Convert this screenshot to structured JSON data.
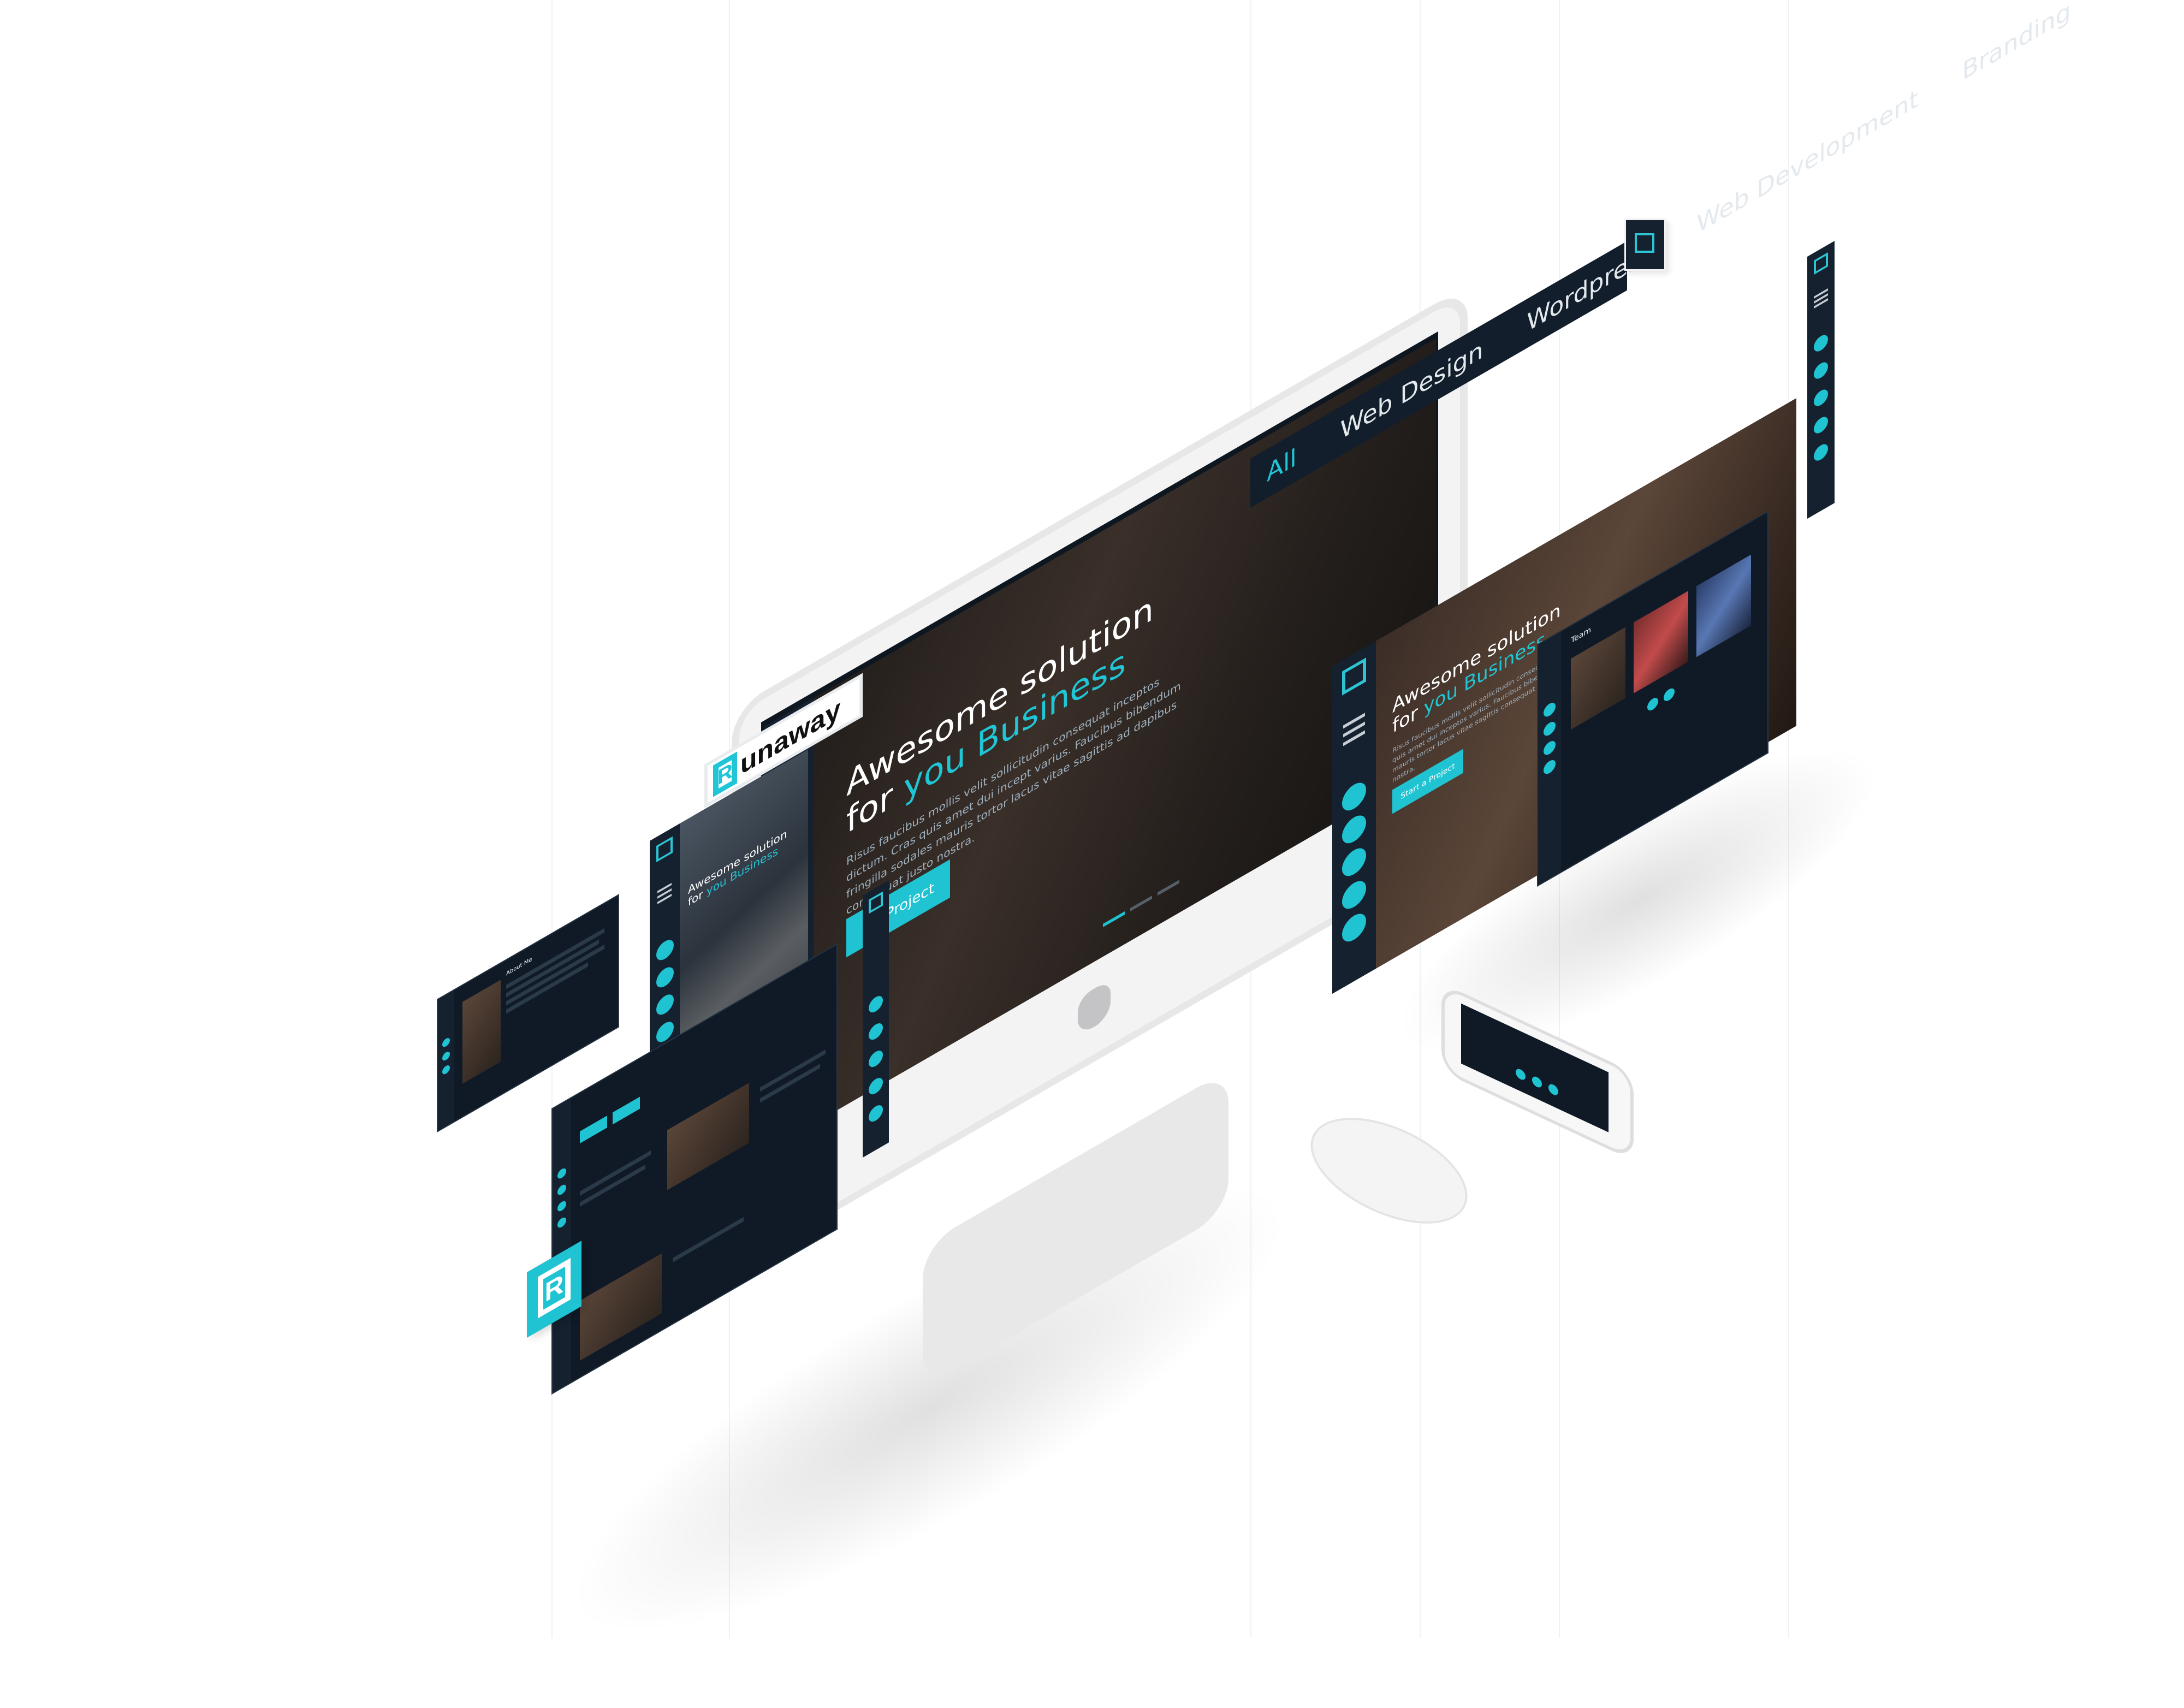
{
  "hero": {
    "title_line1": "Awesome solution",
    "title_for": "for",
    "title_accent": "you Business",
    "body": "Risus faucibus mollis velit sollicitudin consequat inceptos dictum. Cras quis amet dui incept varius. Faucibus bibendum fringilla sodales mauris tortor lacus vitae sagittis ad dapibus consequat justo nostra.",
    "cta_label": "Start a Project",
    "cta_partial": "t a Project"
  },
  "right_hero": {
    "title_line1": "Awesome solution",
    "title_for": "for",
    "title_accent": "you Business",
    "body": "Risus faucibus mollis velit sollicitudin consequat inceptos dictum. Cras quis amet dui inceptos varius. Faucibus bibendum fringilla sodales mauris tortor lacus vitae sagittis consequat dapibus consequat justo nostra.",
    "cta_label": "Start a Project"
  },
  "small_hero": {
    "title_line1": "Awesome solution",
    "title_for": "for",
    "title_accent": "you Business"
  },
  "filter_nav": {
    "items": [
      "All",
      "Web Design",
      "Wordpress",
      "Web Development",
      "Branding"
    ]
  },
  "brand": {
    "mark": "R",
    "word": "unaway"
  },
  "team_panel": {
    "title": "Team"
  },
  "about_panel": {
    "title": "About Me"
  },
  "colors": {
    "accent": "#1fc3d2",
    "panel_dark": "#0f1a26",
    "sidebar": "#15212f"
  }
}
